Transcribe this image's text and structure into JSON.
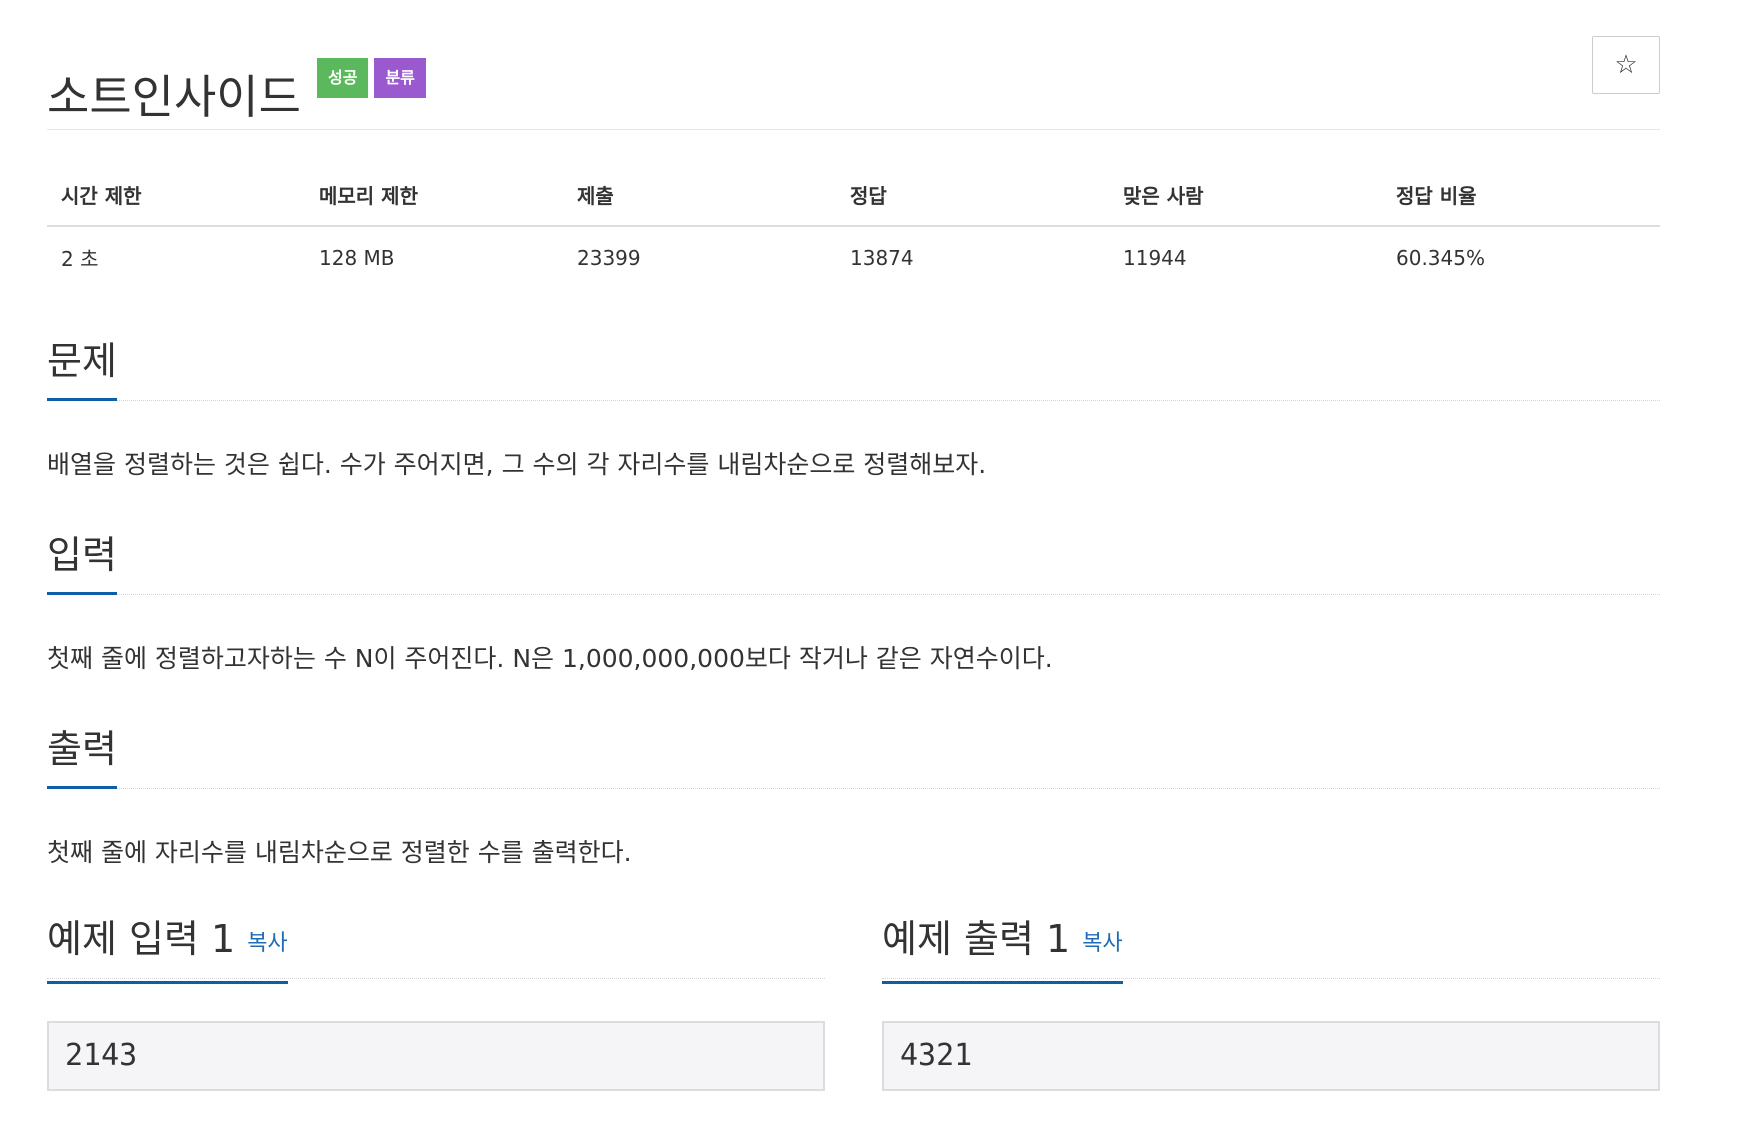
{
  "problem": {
    "title": "소트인사이드",
    "labels": [
      {
        "text": "성공",
        "color": "#5cb85c"
      },
      {
        "text": "분류",
        "color": "#9b59d0"
      }
    ],
    "star_icon": "star-icon"
  },
  "stats": {
    "headers": [
      "시간 제한",
      "메모리 제한",
      "제출",
      "정답",
      "맞은 사람",
      "정답 비율"
    ],
    "values": [
      "2 초",
      "128 MB",
      "23399",
      "13874",
      "11944",
      "60.345%"
    ]
  },
  "sections": {
    "description": {
      "title": "문제",
      "text": "배열을 정렬하는 것은 쉽다. 수가 주어지면, 그 수의 각 자리수를 내림차순으로 정렬해보자."
    },
    "input": {
      "title": "입력",
      "text": "첫째 줄에 정렬하고자하는 수 N이 주어진다. N은 1,000,000,000보다 작거나 같은 자연수이다."
    },
    "output": {
      "title": "출력",
      "text": "첫째 줄에 자리수를 내림차순으로 정렬한 수를 출력한다."
    }
  },
  "samples": {
    "input": {
      "title": "예제 입력 1",
      "copy_label": "복사",
      "value": "2143"
    },
    "output": {
      "title": "예제 출력 1",
      "copy_label": "복사",
      "value": "4321"
    }
  },
  "colors": {
    "accent": "#0e5ea8",
    "link": "#1f6bb5",
    "success": "#5cb85c",
    "category": "#9b59d0"
  }
}
